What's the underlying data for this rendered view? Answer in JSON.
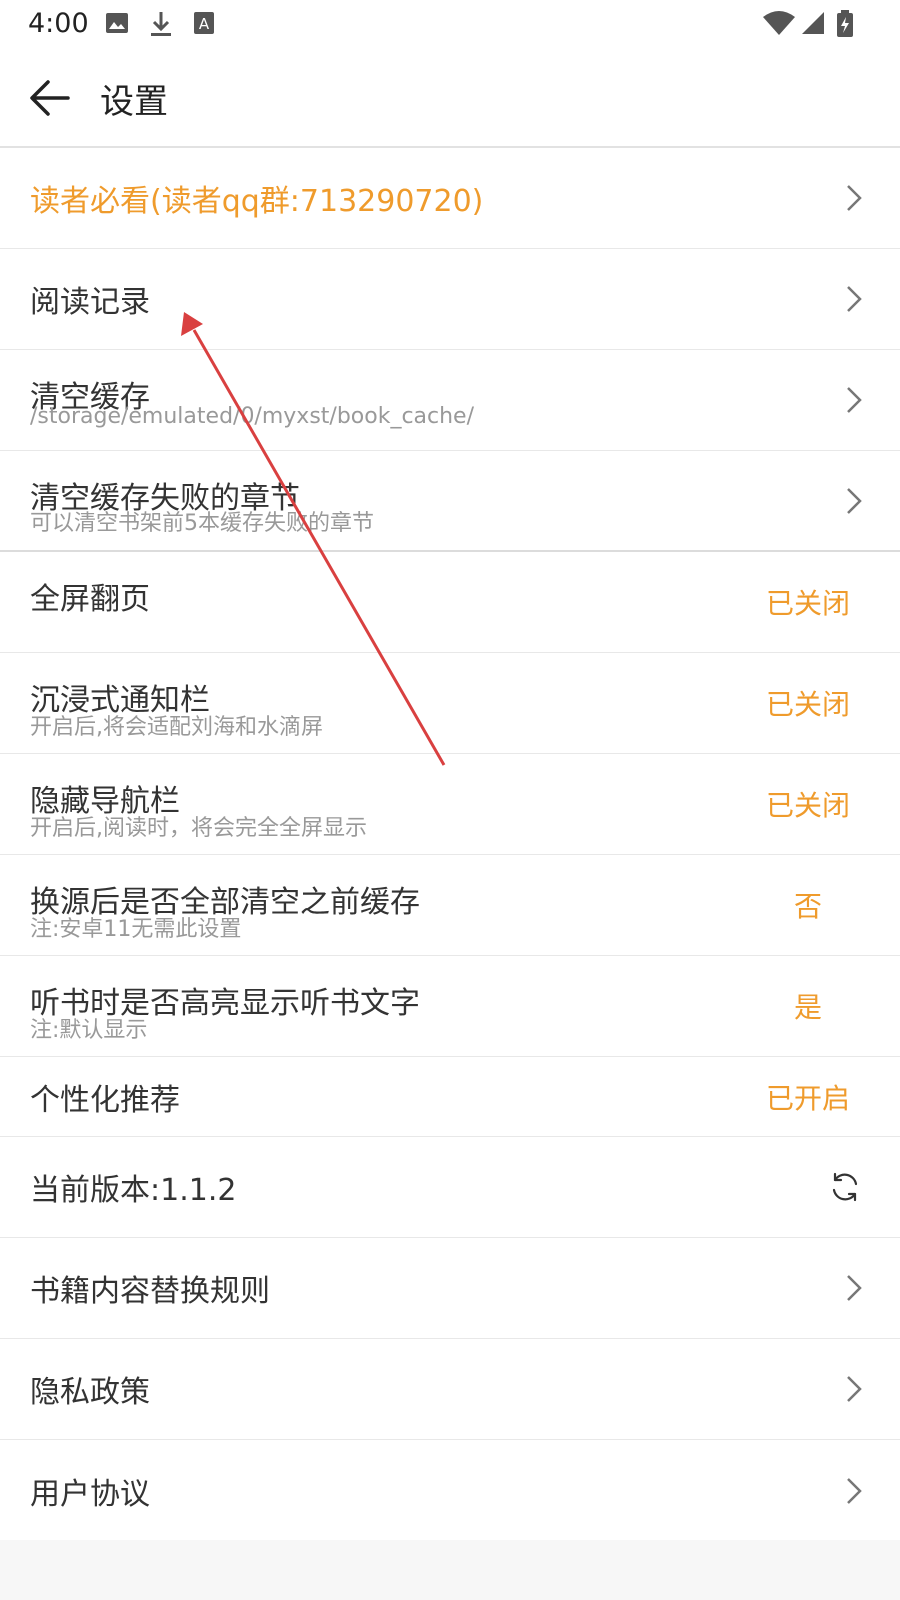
{
  "statusbar": {
    "time": "4:00",
    "left_icons": [
      "image-icon",
      "download-icon",
      "font-icon"
    ],
    "right_icons": [
      "wifi-icon",
      "signal-icon",
      "battery-charging-icon"
    ]
  },
  "header": {
    "back_icon": "arrow-left-icon",
    "title": "设置"
  },
  "colors": {
    "accent": "#ef9b2c",
    "text": "#333333",
    "subtext": "#999999",
    "annotation_arrow": "#d94040"
  },
  "settings": {
    "items": [
      {
        "label": "读者必看(读者qq群:713290720)",
        "accent": true,
        "action": "chevron"
      },
      {
        "label": "阅读记录",
        "action": "chevron"
      },
      {
        "label": "清空缓存",
        "subtitle": "/storage/emulated/0/myxst/book_cache/",
        "action": "chevron"
      },
      {
        "label": "清空缓存失败的章节",
        "subtitle": "可以清空书架前5本缓存失败的章节",
        "action": "chevron"
      },
      {
        "label": "全屏翻页",
        "value": "已关闭"
      },
      {
        "label": "沉浸式通知栏",
        "subtitle": "开启后,将会适配刘海和水滴屏",
        "value": "已关闭"
      },
      {
        "label": "隐藏导航栏",
        "subtitle": "开启后,阅读时，将会完全全屏显示",
        "value": "已关闭"
      },
      {
        "label": "换源后是否全部清空之前缓存",
        "subtitle": "注:安卓11无需此设置",
        "value": "否"
      },
      {
        "label": "听书时是否高亮显示听书文字",
        "subtitle": "注:默认显示",
        "value": "是"
      },
      {
        "label": "个性化推荐",
        "value": "已开启"
      },
      {
        "label": "当前版本:1.1.2",
        "action": "sync-icon"
      },
      {
        "label": "书籍内容替换规则",
        "action": "chevron"
      },
      {
        "label": "隐私政策",
        "action": "chevron"
      },
      {
        "label": "用户协议",
        "action": "chevron"
      }
    ]
  }
}
